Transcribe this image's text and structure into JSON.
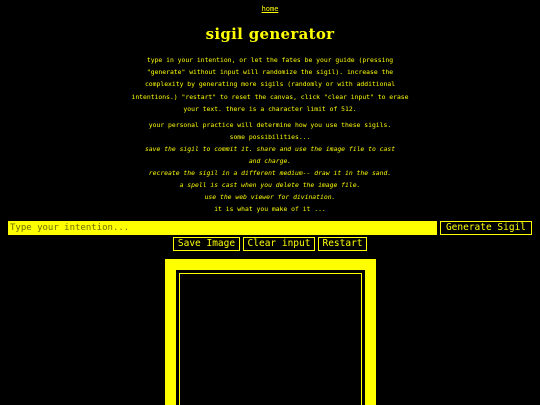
{
  "nav": {
    "home_label": "home"
  },
  "header": {
    "title": "sigil generator"
  },
  "intro": {
    "text": "type in your intention, or let the fates be your guide (pressing \"generate\" without input will randomize the sigil). increase the complexity by generating more sigils (randomly or with additional intentions.) \"restart\" to reset the canvas, click \"clear input\" to erase your text. there is a character limit of 512."
  },
  "practice": {
    "lines": [
      "your personal practice will determine how you use these sigils.",
      "some possibilities...",
      "save the sigil to commit it. share and use the image file to cast",
      "and charge.",
      "recreate the sigil in a different medium-- draw it in the sand.",
      "a spell is cast when you delete the image file.",
      "use the web viewer for divination.",
      "it is what you make of it ..."
    ]
  },
  "controls": {
    "input_placeholder": "Type your intention...",
    "input_value": "",
    "generate_label": "Generate Sigil",
    "save_label": "Save Image",
    "clear_label": "Clear input",
    "restart_label": "Restart"
  },
  "colors": {
    "background": "#000000",
    "accent": "#ffff00"
  }
}
